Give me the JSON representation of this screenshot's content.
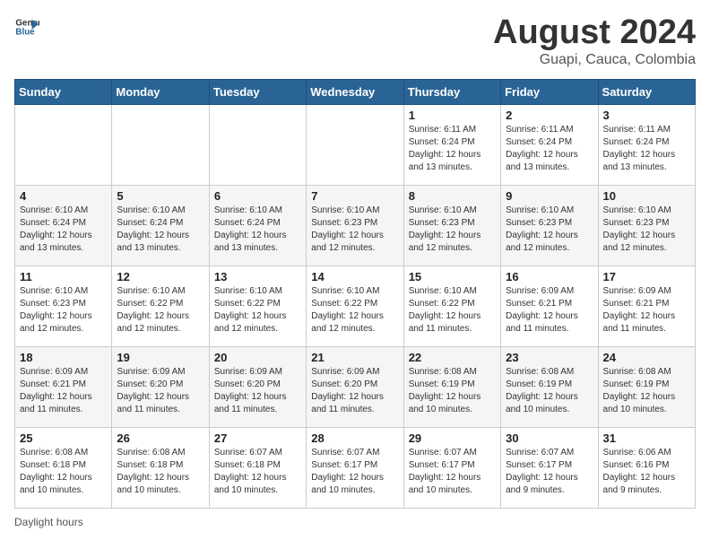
{
  "header": {
    "logo_line1": "General",
    "logo_line2": "Blue",
    "month_year": "August 2024",
    "location": "Guapi, Cauca, Colombia"
  },
  "days_of_week": [
    "Sunday",
    "Monday",
    "Tuesday",
    "Wednesday",
    "Thursday",
    "Friday",
    "Saturday"
  ],
  "weeks": [
    [
      {
        "day": "",
        "info": ""
      },
      {
        "day": "",
        "info": ""
      },
      {
        "day": "",
        "info": ""
      },
      {
        "day": "",
        "info": ""
      },
      {
        "day": "1",
        "info": "Sunrise: 6:11 AM\nSunset: 6:24 PM\nDaylight: 12 hours\nand 13 minutes."
      },
      {
        "day": "2",
        "info": "Sunrise: 6:11 AM\nSunset: 6:24 PM\nDaylight: 12 hours\nand 13 minutes."
      },
      {
        "day": "3",
        "info": "Sunrise: 6:11 AM\nSunset: 6:24 PM\nDaylight: 12 hours\nand 13 minutes."
      }
    ],
    [
      {
        "day": "4",
        "info": "Sunrise: 6:10 AM\nSunset: 6:24 PM\nDaylight: 12 hours\nand 13 minutes."
      },
      {
        "day": "5",
        "info": "Sunrise: 6:10 AM\nSunset: 6:24 PM\nDaylight: 12 hours\nand 13 minutes."
      },
      {
        "day": "6",
        "info": "Sunrise: 6:10 AM\nSunset: 6:24 PM\nDaylight: 12 hours\nand 13 minutes."
      },
      {
        "day": "7",
        "info": "Sunrise: 6:10 AM\nSunset: 6:23 PM\nDaylight: 12 hours\nand 12 minutes."
      },
      {
        "day": "8",
        "info": "Sunrise: 6:10 AM\nSunset: 6:23 PM\nDaylight: 12 hours\nand 12 minutes."
      },
      {
        "day": "9",
        "info": "Sunrise: 6:10 AM\nSunset: 6:23 PM\nDaylight: 12 hours\nand 12 minutes."
      },
      {
        "day": "10",
        "info": "Sunrise: 6:10 AM\nSunset: 6:23 PM\nDaylight: 12 hours\nand 12 minutes."
      }
    ],
    [
      {
        "day": "11",
        "info": "Sunrise: 6:10 AM\nSunset: 6:23 PM\nDaylight: 12 hours\nand 12 minutes."
      },
      {
        "day": "12",
        "info": "Sunrise: 6:10 AM\nSunset: 6:22 PM\nDaylight: 12 hours\nand 12 minutes."
      },
      {
        "day": "13",
        "info": "Sunrise: 6:10 AM\nSunset: 6:22 PM\nDaylight: 12 hours\nand 12 minutes."
      },
      {
        "day": "14",
        "info": "Sunrise: 6:10 AM\nSunset: 6:22 PM\nDaylight: 12 hours\nand 12 minutes."
      },
      {
        "day": "15",
        "info": "Sunrise: 6:10 AM\nSunset: 6:22 PM\nDaylight: 12 hours\nand 11 minutes."
      },
      {
        "day": "16",
        "info": "Sunrise: 6:09 AM\nSunset: 6:21 PM\nDaylight: 12 hours\nand 11 minutes."
      },
      {
        "day": "17",
        "info": "Sunrise: 6:09 AM\nSunset: 6:21 PM\nDaylight: 12 hours\nand 11 minutes."
      }
    ],
    [
      {
        "day": "18",
        "info": "Sunrise: 6:09 AM\nSunset: 6:21 PM\nDaylight: 12 hours\nand 11 minutes."
      },
      {
        "day": "19",
        "info": "Sunrise: 6:09 AM\nSunset: 6:20 PM\nDaylight: 12 hours\nand 11 minutes."
      },
      {
        "day": "20",
        "info": "Sunrise: 6:09 AM\nSunset: 6:20 PM\nDaylight: 12 hours\nand 11 minutes."
      },
      {
        "day": "21",
        "info": "Sunrise: 6:09 AM\nSunset: 6:20 PM\nDaylight: 12 hours\nand 11 minutes."
      },
      {
        "day": "22",
        "info": "Sunrise: 6:08 AM\nSunset: 6:19 PM\nDaylight: 12 hours\nand 10 minutes."
      },
      {
        "day": "23",
        "info": "Sunrise: 6:08 AM\nSunset: 6:19 PM\nDaylight: 12 hours\nand 10 minutes."
      },
      {
        "day": "24",
        "info": "Sunrise: 6:08 AM\nSunset: 6:19 PM\nDaylight: 12 hours\nand 10 minutes."
      }
    ],
    [
      {
        "day": "25",
        "info": "Sunrise: 6:08 AM\nSunset: 6:18 PM\nDaylight: 12 hours\nand 10 minutes."
      },
      {
        "day": "26",
        "info": "Sunrise: 6:08 AM\nSunset: 6:18 PM\nDaylight: 12 hours\nand 10 minutes."
      },
      {
        "day": "27",
        "info": "Sunrise: 6:07 AM\nSunset: 6:18 PM\nDaylight: 12 hours\nand 10 minutes."
      },
      {
        "day": "28",
        "info": "Sunrise: 6:07 AM\nSunset: 6:17 PM\nDaylight: 12 hours\nand 10 minutes."
      },
      {
        "day": "29",
        "info": "Sunrise: 6:07 AM\nSunset: 6:17 PM\nDaylight: 12 hours\nand 10 minutes."
      },
      {
        "day": "30",
        "info": "Sunrise: 6:07 AM\nSunset: 6:17 PM\nDaylight: 12 hours\nand 9 minutes."
      },
      {
        "day": "31",
        "info": "Sunrise: 6:06 AM\nSunset: 6:16 PM\nDaylight: 12 hours\nand 9 minutes."
      }
    ]
  ],
  "footer": {
    "text": "Daylight hours"
  }
}
